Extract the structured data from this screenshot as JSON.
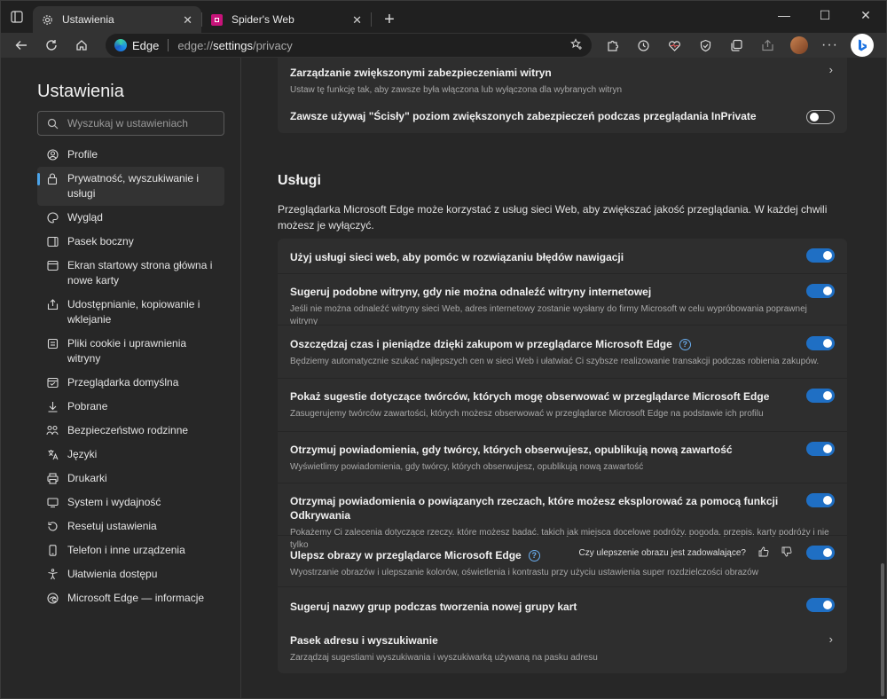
{
  "tabs": [
    {
      "label": "Ustawienia",
      "icon": "gear-icon",
      "active": true
    },
    {
      "label": "Spider's Web",
      "icon": "spidersweb-favicon",
      "active": false
    }
  ],
  "toolbar": {
    "brand": "Edge",
    "url_prefix": "edge://",
    "url_host": "settings",
    "url_path": "/privacy"
  },
  "sidebar": {
    "title": "Ustawienia",
    "search_placeholder": "Wyszukaj w ustawieniach",
    "items": [
      {
        "label": "Profile",
        "icon": "profile-icon"
      },
      {
        "label": "Prywatność, wyszukiwanie i usługi",
        "icon": "lock-icon",
        "active": true
      },
      {
        "label": "Wygląd",
        "icon": "appearance-icon"
      },
      {
        "label": "Pasek boczny",
        "icon": "sidebar-icon"
      },
      {
        "label": "Ekran startowy strona główna i nowe karty",
        "icon": "home-tabs-icon"
      },
      {
        "label": "Udostępnianie, kopiowanie i wklejanie",
        "icon": "share-icon"
      },
      {
        "label": "Pliki cookie i uprawnienia witryny",
        "icon": "cookie-icon"
      },
      {
        "label": "Przeglądarka domyślna",
        "icon": "browser-icon"
      },
      {
        "label": "Pobrane",
        "icon": "download-icon"
      },
      {
        "label": "Bezpieczeństwo rodzinne",
        "icon": "family-icon"
      },
      {
        "label": "Języki",
        "icon": "language-icon"
      },
      {
        "label": "Drukarki",
        "icon": "printer-icon"
      },
      {
        "label": "System i wydajność",
        "icon": "system-icon"
      },
      {
        "label": "Resetuj ustawienia",
        "icon": "reset-icon"
      },
      {
        "label": "Telefon i inne urządzenia",
        "icon": "phone-icon"
      },
      {
        "label": "Ułatwienia dostępu",
        "icon": "accessibility-icon"
      },
      {
        "label": "Microsoft Edge — informacje",
        "icon": "edge-icon"
      }
    ]
  },
  "top_card": {
    "manage_title": "Zarządzanie zwiększonymi zabezpieczeniami witryn",
    "manage_desc": "Ustaw tę funkcję tak, aby zawsze była włączona lub wyłączona dla wybranych witryn",
    "strict_title": "Zawsze używaj \"Ścisły\" poziom zwiększonych zabezpieczeń podczas przeglądania InPrivate",
    "strict_on": false
  },
  "services": {
    "title": "Usługi",
    "description": "Przeglądarka Microsoft Edge może korzystać z usług sieci Web, aby zwiększać jakość przeglądania. W każdej chwili możesz je wyłączyć.",
    "rows": [
      {
        "title": "Użyj usługi sieci web, aby pomóc w rozwiązaniu błędów nawigacji",
        "desc": "",
        "on": true
      },
      {
        "title": "Sugeruj podobne witryny, gdy nie można odnaleźć witryny internetowej",
        "desc": "Jeśli nie można odnaleźć witryny sieci Web, adres internetowy zostanie wysłany do firmy Microsoft w celu wypróbowania poprawnej witryny",
        "on": true
      },
      {
        "title": "Oszczędzaj czas i pieniądze dzięki zakupom w przeglądarce Microsoft Edge",
        "desc": "Będziemy automatycznie szukać najlepszych cen w sieci Web i ułatwiać Ci szybsze realizowanie transakcji podczas robienia zakupów.",
        "on": true,
        "help": "?"
      },
      {
        "title": "Pokaż sugestie dotyczące twórców, których mogę obserwować w przeglądarce Microsoft Edge",
        "desc": "Zasugerujemy twórców zawartości, których możesz obserwować w przeglądarce Microsoft Edge na podstawie ich profilu",
        "on": true
      },
      {
        "title": "Otrzymuj powiadomienia, gdy twórcy, których obserwujesz, opublikują nową zawartość",
        "desc": "Wyświetlimy powiadomienia, gdy twórcy, których obserwujesz, opublikują nową zawartość",
        "on": true
      },
      {
        "title": "Otrzymaj powiadomienia o powiązanych rzeczach, które możesz eksplorować za pomocą funkcji Odkrywania",
        "desc": "Pokażemy Ci zalecenia dotyczące rzeczy, które możesz badać, takich jak miejsca docelowe podróży, pogoda, przepis, karty podróży i nie tylko",
        "on": true
      },
      {
        "title": "Ulepsz obrazy w przeglądarce Microsoft Edge",
        "desc": "Wyostrzanie obrazów i ulepszanie kolorów, oświetlenia i kontrastu przy użyciu ustawienia super rozdzielczości obrazów",
        "on": true,
        "help": "?",
        "feedback": "Czy ulepszenie obrazu jest zadowalające?"
      },
      {
        "title": "Sugeruj nazwy grup podczas tworzenia nowej grupy kart",
        "desc": "",
        "on": true
      },
      {
        "title": "Pasek adresu i wyszukiwanie",
        "desc": "Zarządzaj sugestiami wyszukiwania i wyszukiwarką używaną na pasku adresu",
        "chevron": true
      }
    ]
  }
}
